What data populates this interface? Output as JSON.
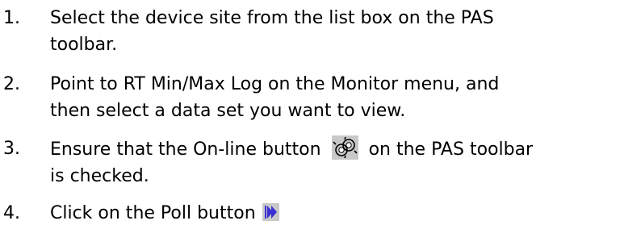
{
  "steps": [
    {
      "number": "1.",
      "line1": "Select the device site from the list box on the PAS",
      "line2": "toolbar."
    },
    {
      "number": "2.",
      "line1": "Point to RT Min/Max Log on the Monitor menu, and",
      "line2": "then select a data set you want to view."
    },
    {
      "number": "3.",
      "line1_before": "Ensure that the On-line button",
      "line1_after": "on the PAS toolbar",
      "line2": "is checked.",
      "icon": "online-icon"
    },
    {
      "number": "4.",
      "line1_before": "Click on the Poll button",
      "icon": "poll-icon"
    }
  ],
  "colors": {
    "text": "#000000",
    "icon_bg": "#c8c8c8",
    "poll_icon": "#3a2fd0",
    "online_icon_dark": "#000000",
    "online_icon_light": "#ffffff"
  }
}
